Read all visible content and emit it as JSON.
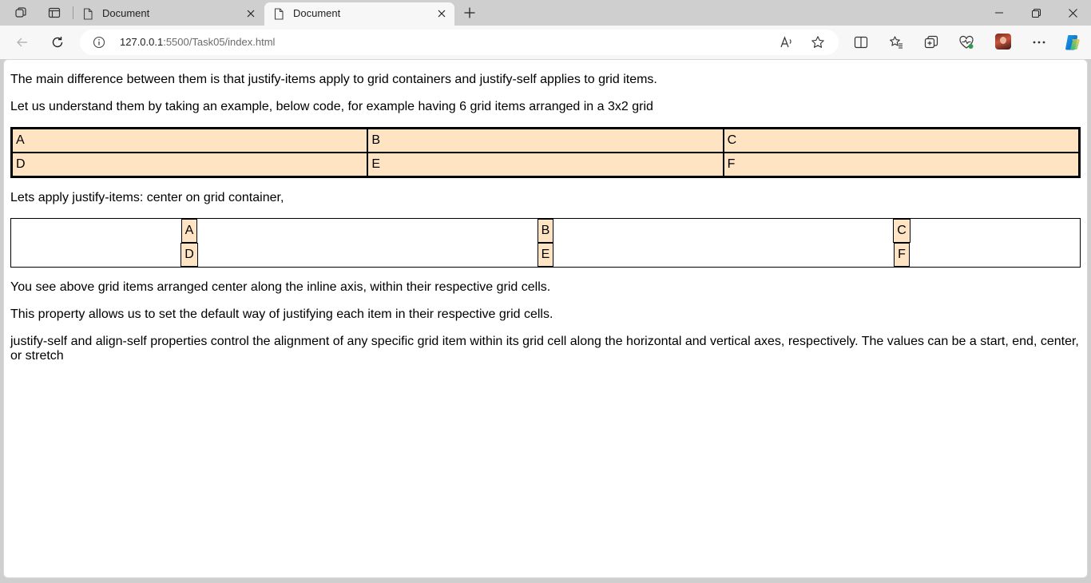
{
  "browser": {
    "tabs": [
      {
        "title": "Document",
        "active": false
      },
      {
        "title": "Document",
        "active": true
      }
    ],
    "url_host": "127.0.0.1",
    "url_path": ":5500/Task05/index.html"
  },
  "page": {
    "para1": "The main difference between them is that justify-items apply to grid containers and justify-self applies to grid items.",
    "para2": "Let us understand them by taking an example, below code, for example having 6 grid items arranged in a 3x2 grid",
    "grid1": [
      "A",
      "B",
      "C",
      "D",
      "E",
      "F"
    ],
    "para3": "Lets apply justify-items: center on grid container,",
    "grid2": [
      "A",
      "B",
      "C",
      "D",
      "E",
      "F"
    ],
    "para4": "You see above grid items arranged center along the inline axis, within their respective grid cells.",
    "para5": "This property allows us to set the default way of justifying each item in their respective grid cells.",
    "para6": "justify-self and align-self properties control the alignment of any specific grid item within its grid cell along the horizontal and vertical axes, respectively. The values can be a start, end, center, or stretch"
  },
  "colors": {
    "grid_item_bg": "#ffe4c4",
    "chrome_bg": "#cfcfcf",
    "toolbar_bg": "#f7f7f7"
  }
}
